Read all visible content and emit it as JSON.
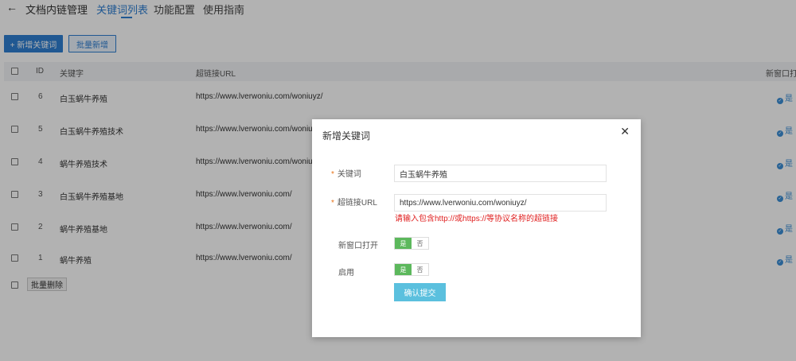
{
  "nav": {
    "back_icon": "←",
    "title": "文档内链管理",
    "tabs": [
      {
        "label": "关键词列表",
        "active": true
      },
      {
        "label": "功能配置",
        "active": false
      },
      {
        "label": "使用指南",
        "active": false
      }
    ]
  },
  "toolbar": {
    "add_label": "+ 新增关键词",
    "batch_add_label": "批量新增"
  },
  "table": {
    "columns": [
      "ID",
      "关键字",
      "超链接URL",
      "新窗口打开"
    ],
    "rows": [
      {
        "id": "6",
        "keyword": "白玉蜗牛养殖",
        "url": "https://www.lverwoniu.com/woniuyz/",
        "new_window": "是"
      },
      {
        "id": "5",
        "keyword": "白玉蜗牛养殖技术",
        "url": "https://www.lverwoniu.com/woniuyz/",
        "new_window": "是"
      },
      {
        "id": "4",
        "keyword": "蜗牛养殖技术",
        "url": "https://www.lverwoniu.com/woniuyz/",
        "new_window": "是"
      },
      {
        "id": "3",
        "keyword": "白玉蜗牛养殖基地",
        "url": "https://www.lverwoniu.com/",
        "new_window": "是"
      },
      {
        "id": "2",
        "keyword": "蜗牛养殖基地",
        "url": "https://www.lverwoniu.com/",
        "new_window": "是"
      },
      {
        "id": "1",
        "keyword": "蜗牛养殖",
        "url": "https://www.lverwoniu.com/",
        "new_window": "是"
      }
    ],
    "batch_delete_label": "批量删除"
  },
  "modal": {
    "title": "新增关键词",
    "close_icon": "✕",
    "required_mark": "*",
    "keyword_label": "关键词",
    "keyword_value": "白玉蜗牛养殖",
    "url_label": "超链接URL",
    "url_value": "https://www.lverwoniu.com/woniuyz/",
    "url_error": "请输入包含http://或https://等协议名称的超链接",
    "new_window_label": "新窗口打开",
    "new_window_on": "是",
    "new_window_off": "否",
    "enable_label": "启用",
    "enable_on": "是",
    "enable_off": "否",
    "submit_label": "确认提交"
  },
  "colors": {
    "primary": "#2f7fd2",
    "success": "#5cb85c",
    "info": "#5bc0de",
    "error": "#e02020",
    "required": "#e8731a"
  }
}
